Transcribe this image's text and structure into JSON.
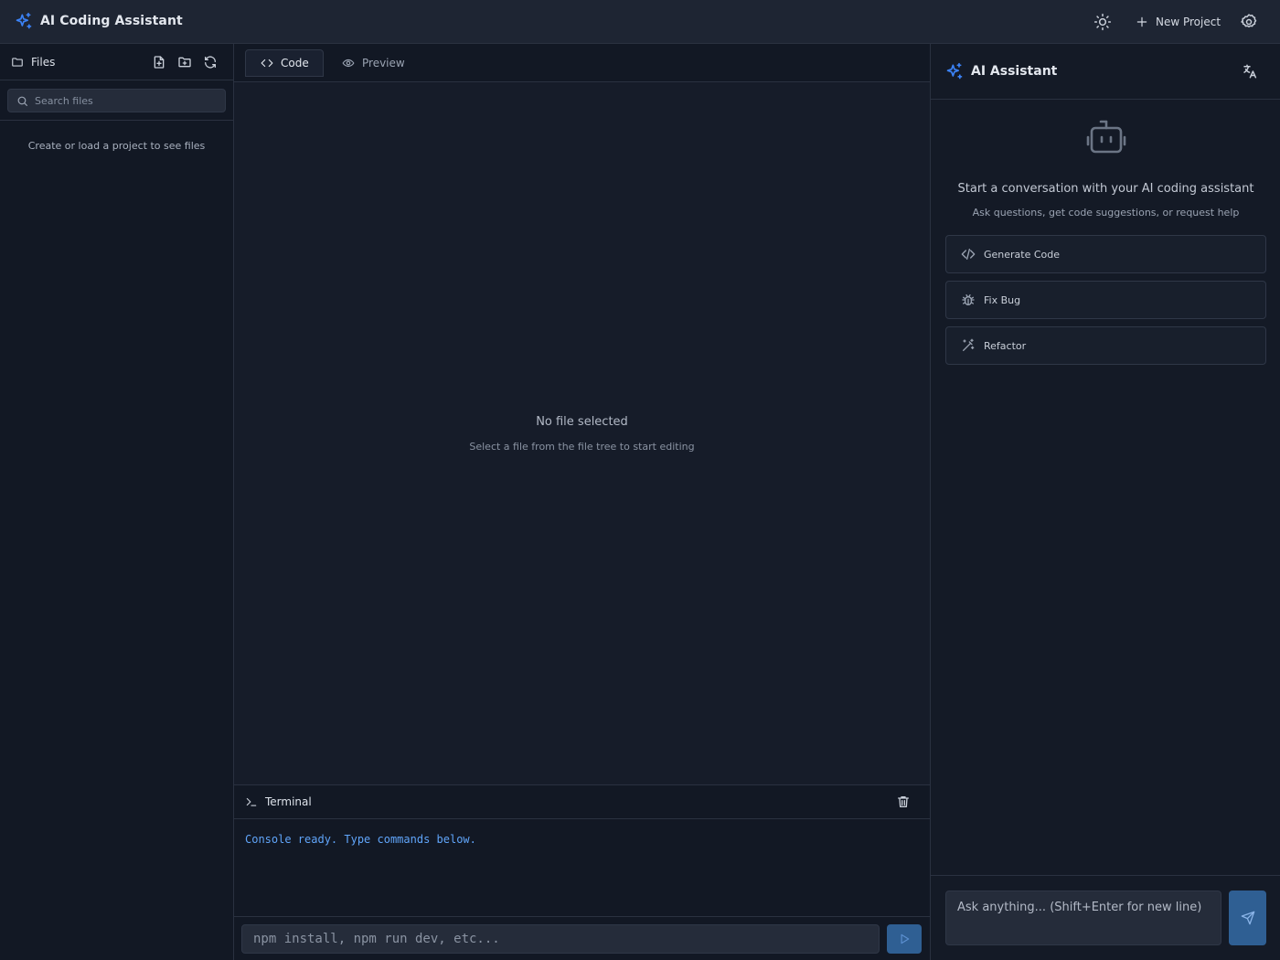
{
  "app": {
    "title": "AI Coding Assistant"
  },
  "header": {
    "new_project_label": "New Project"
  },
  "files": {
    "title": "Files",
    "search_placeholder": "Search files",
    "empty_message": "Create or load a project to see files"
  },
  "editor": {
    "tabs": [
      {
        "label": "Code"
      },
      {
        "label": "Preview"
      }
    ],
    "empty_title": "No file selected",
    "empty_subtitle": "Select a file from the file tree to start editing"
  },
  "terminal": {
    "title": "Terminal",
    "output": "Console ready. Type commands below.",
    "input_placeholder": "npm install, npm run dev, etc..."
  },
  "assistant": {
    "title": "AI Assistant",
    "intro": "Start a conversation with your AI coding assistant",
    "intro_sub": "Ask questions, get code suggestions, or request help",
    "quick_actions": [
      {
        "label": "Generate Code",
        "icon": "code-icon"
      },
      {
        "label": "Fix Bug",
        "icon": "bug-icon"
      },
      {
        "label": "Refactor",
        "icon": "wand-icon"
      }
    ],
    "input_placeholder": "Ask anything... (Shift+Enter for new line)"
  },
  "colors": {
    "accent": "#3b82f6",
    "terminal_text": "#60a5fa",
    "button_bg": "#2f5f93"
  }
}
